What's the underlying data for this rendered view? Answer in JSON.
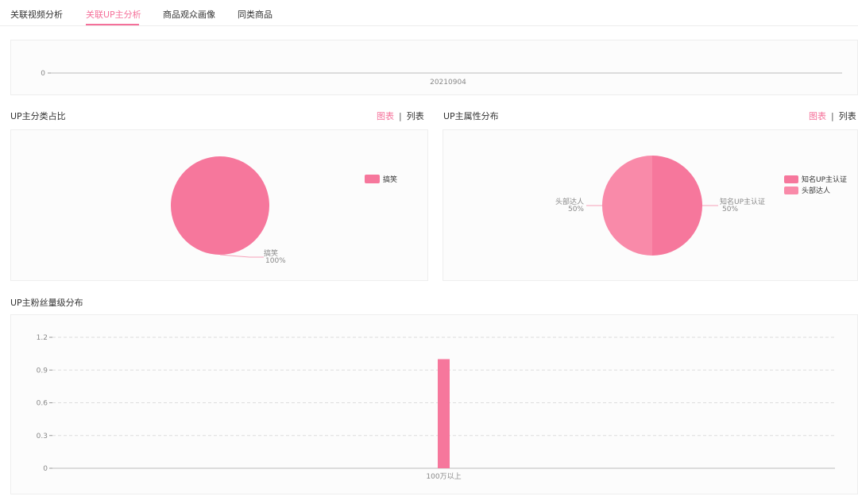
{
  "tabs": [
    {
      "label": "关联视频分析"
    },
    {
      "label": "关联UP主分析"
    },
    {
      "label": "商品观众画像"
    },
    {
      "label": "同类商品"
    }
  ],
  "colors": {
    "accent": "#f5709a",
    "pie_primary": "#f6779c",
    "pie_secondary": "#f98aa9",
    "bar": "#f6779c"
  },
  "trend_chart": {
    "y_tick": "0",
    "x_tick": "20210904"
  },
  "up_category": {
    "title": "UP主分类占比",
    "toggle_chart": "图表",
    "toggle_separator": "|",
    "toggle_list": "列表",
    "chart_data": {
      "type": "pie",
      "slices": [
        {
          "label": "搞笑",
          "value": 100,
          "label_text": "100%"
        }
      ],
      "legend": [
        "搞笑"
      ]
    }
  },
  "up_attribute": {
    "title": "UP主属性分布",
    "toggle_chart": "图表",
    "toggle_separator": "|",
    "toggle_list": "列表",
    "chart_data": {
      "type": "pie",
      "slices": [
        {
          "label": "知名UP主认证",
          "value": 50,
          "label_text": "50%"
        },
        {
          "label": "头部达人",
          "value": 50,
          "label_text": "50%"
        }
      ],
      "legend": [
        "知名UP主认证",
        "头部达人"
      ]
    }
  },
  "fans": {
    "title": "UP主粉丝量级分布",
    "chart_data": {
      "type": "bar",
      "categories": [
        "100万以上"
      ],
      "values": [
        1
      ],
      "ylim": [
        0,
        1.2
      ],
      "yticks": [
        "0",
        "0.3",
        "0.6",
        "0.9",
        "1.2"
      ],
      "grid": true
    }
  }
}
